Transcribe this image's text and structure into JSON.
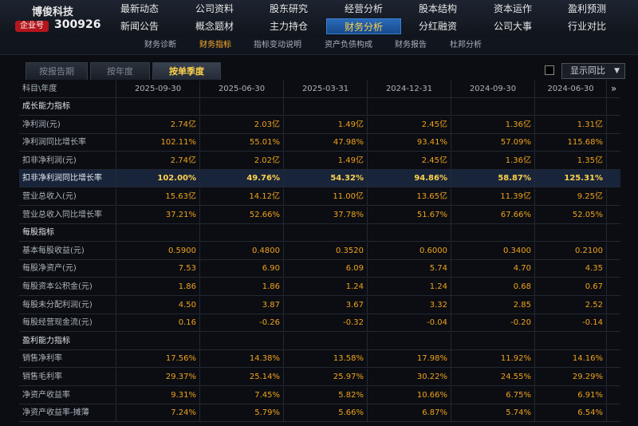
{
  "brand": {
    "name": "博俊科技",
    "badge": "企业号",
    "code": "300926"
  },
  "nav": [
    [
      "最新动态",
      "公司资料",
      "股东研究",
      "经营分析",
      "股本结构",
      "资本运作",
      "盈利预测"
    ],
    [
      "新闻公告",
      "概念题材",
      "主力持仓",
      "财务分析",
      "分红融资",
      "公司大事",
      "行业对比"
    ]
  ],
  "nav_active": "财务分析",
  "subnav": [
    "财务诊断",
    "财务指标",
    "指标变动说明",
    "资产负债构成",
    "财务报告",
    "杜邦分析"
  ],
  "subnav_active": "财务指标",
  "tabs": [
    "按报告期",
    "按年度",
    "按单季度"
  ],
  "tab_active": "按单季度",
  "compare": {
    "label": "显示同比",
    "arrow": "▼"
  },
  "table": {
    "header_label": "科目\\年度",
    "periods": [
      "2025-09-30",
      "2025-06-30",
      "2025-03-31",
      "2024-12-31",
      "2024-09-30",
      "2024-06-30"
    ],
    "more": "»",
    "rows": [
      {
        "type": "section",
        "label": "成长能力指标"
      },
      {
        "label": "净利润(元)",
        "values": [
          "2.74亿",
          "2.03亿",
          "1.49亿",
          "2.45亿",
          "1.36亿",
          "1.31亿"
        ]
      },
      {
        "label": "净利润同比增长率",
        "values": [
          "102.11%",
          "55.01%",
          "47.98%",
          "93.41%",
          "57.09%",
          "115.68%"
        ]
      },
      {
        "label": "扣非净利润(元)",
        "values": [
          "2.74亿",
          "2.02亿",
          "1.49亿",
          "2.45亿",
          "1.36亿",
          "1.35亿"
        ]
      },
      {
        "label": "扣非净利润同比增长率",
        "highlight": true,
        "values": [
          "102.00%",
          "49.76%",
          "54.32%",
          "94.86%",
          "58.87%",
          "125.31%"
        ]
      },
      {
        "label": "营业总收入(元)",
        "values": [
          "15.63亿",
          "14.12亿",
          "11.00亿",
          "13.65亿",
          "11.39亿",
          "9.25亿"
        ]
      },
      {
        "label": "营业总收入同比增长率",
        "values": [
          "37.21%",
          "52.66%",
          "37.78%",
          "51.67%",
          "67.66%",
          "52.05%"
        ]
      },
      {
        "type": "section",
        "label": "每股指标"
      },
      {
        "label": "基本每股收益(元)",
        "values": [
          "0.5900",
          "0.4800",
          "0.3520",
          "0.6000",
          "0.3400",
          "0.2100"
        ]
      },
      {
        "label": "每股净资产(元)",
        "values": [
          "7.53",
          "6.90",
          "6.09",
          "5.74",
          "4.70",
          "4.35"
        ]
      },
      {
        "label": "每股资本公积金(元)",
        "values": [
          "1.86",
          "1.86",
          "1.24",
          "1.24",
          "0.68",
          "0.67"
        ]
      },
      {
        "label": "每股未分配利润(元)",
        "values": [
          "4.50",
          "3.87",
          "3.67",
          "3.32",
          "2.85",
          "2.52"
        ]
      },
      {
        "label": "每股经营现金流(元)",
        "values": [
          "0.16",
          "-0.26",
          "-0.32",
          "-0.04",
          "-0.20",
          "-0.14"
        ]
      },
      {
        "type": "section",
        "label": "盈利能力指标"
      },
      {
        "label": "销售净利率",
        "values": [
          "17.56%",
          "14.38%",
          "13.58%",
          "17.98%",
          "11.92%",
          "14.16%"
        ]
      },
      {
        "label": "销售毛利率",
        "values": [
          "29.37%",
          "25.14%",
          "25.97%",
          "30.22%",
          "24.55%",
          "29.29%"
        ]
      },
      {
        "label": "净资产收益率",
        "values": [
          "9.31%",
          "7.45%",
          "5.82%",
          "10.66%",
          "6.75%",
          "6.91%"
        ]
      },
      {
        "label": "净资产收益率-摊薄",
        "values": [
          "7.24%",
          "5.79%",
          "5.66%",
          "6.87%",
          "5.74%",
          "6.54%"
        ]
      }
    ]
  }
}
